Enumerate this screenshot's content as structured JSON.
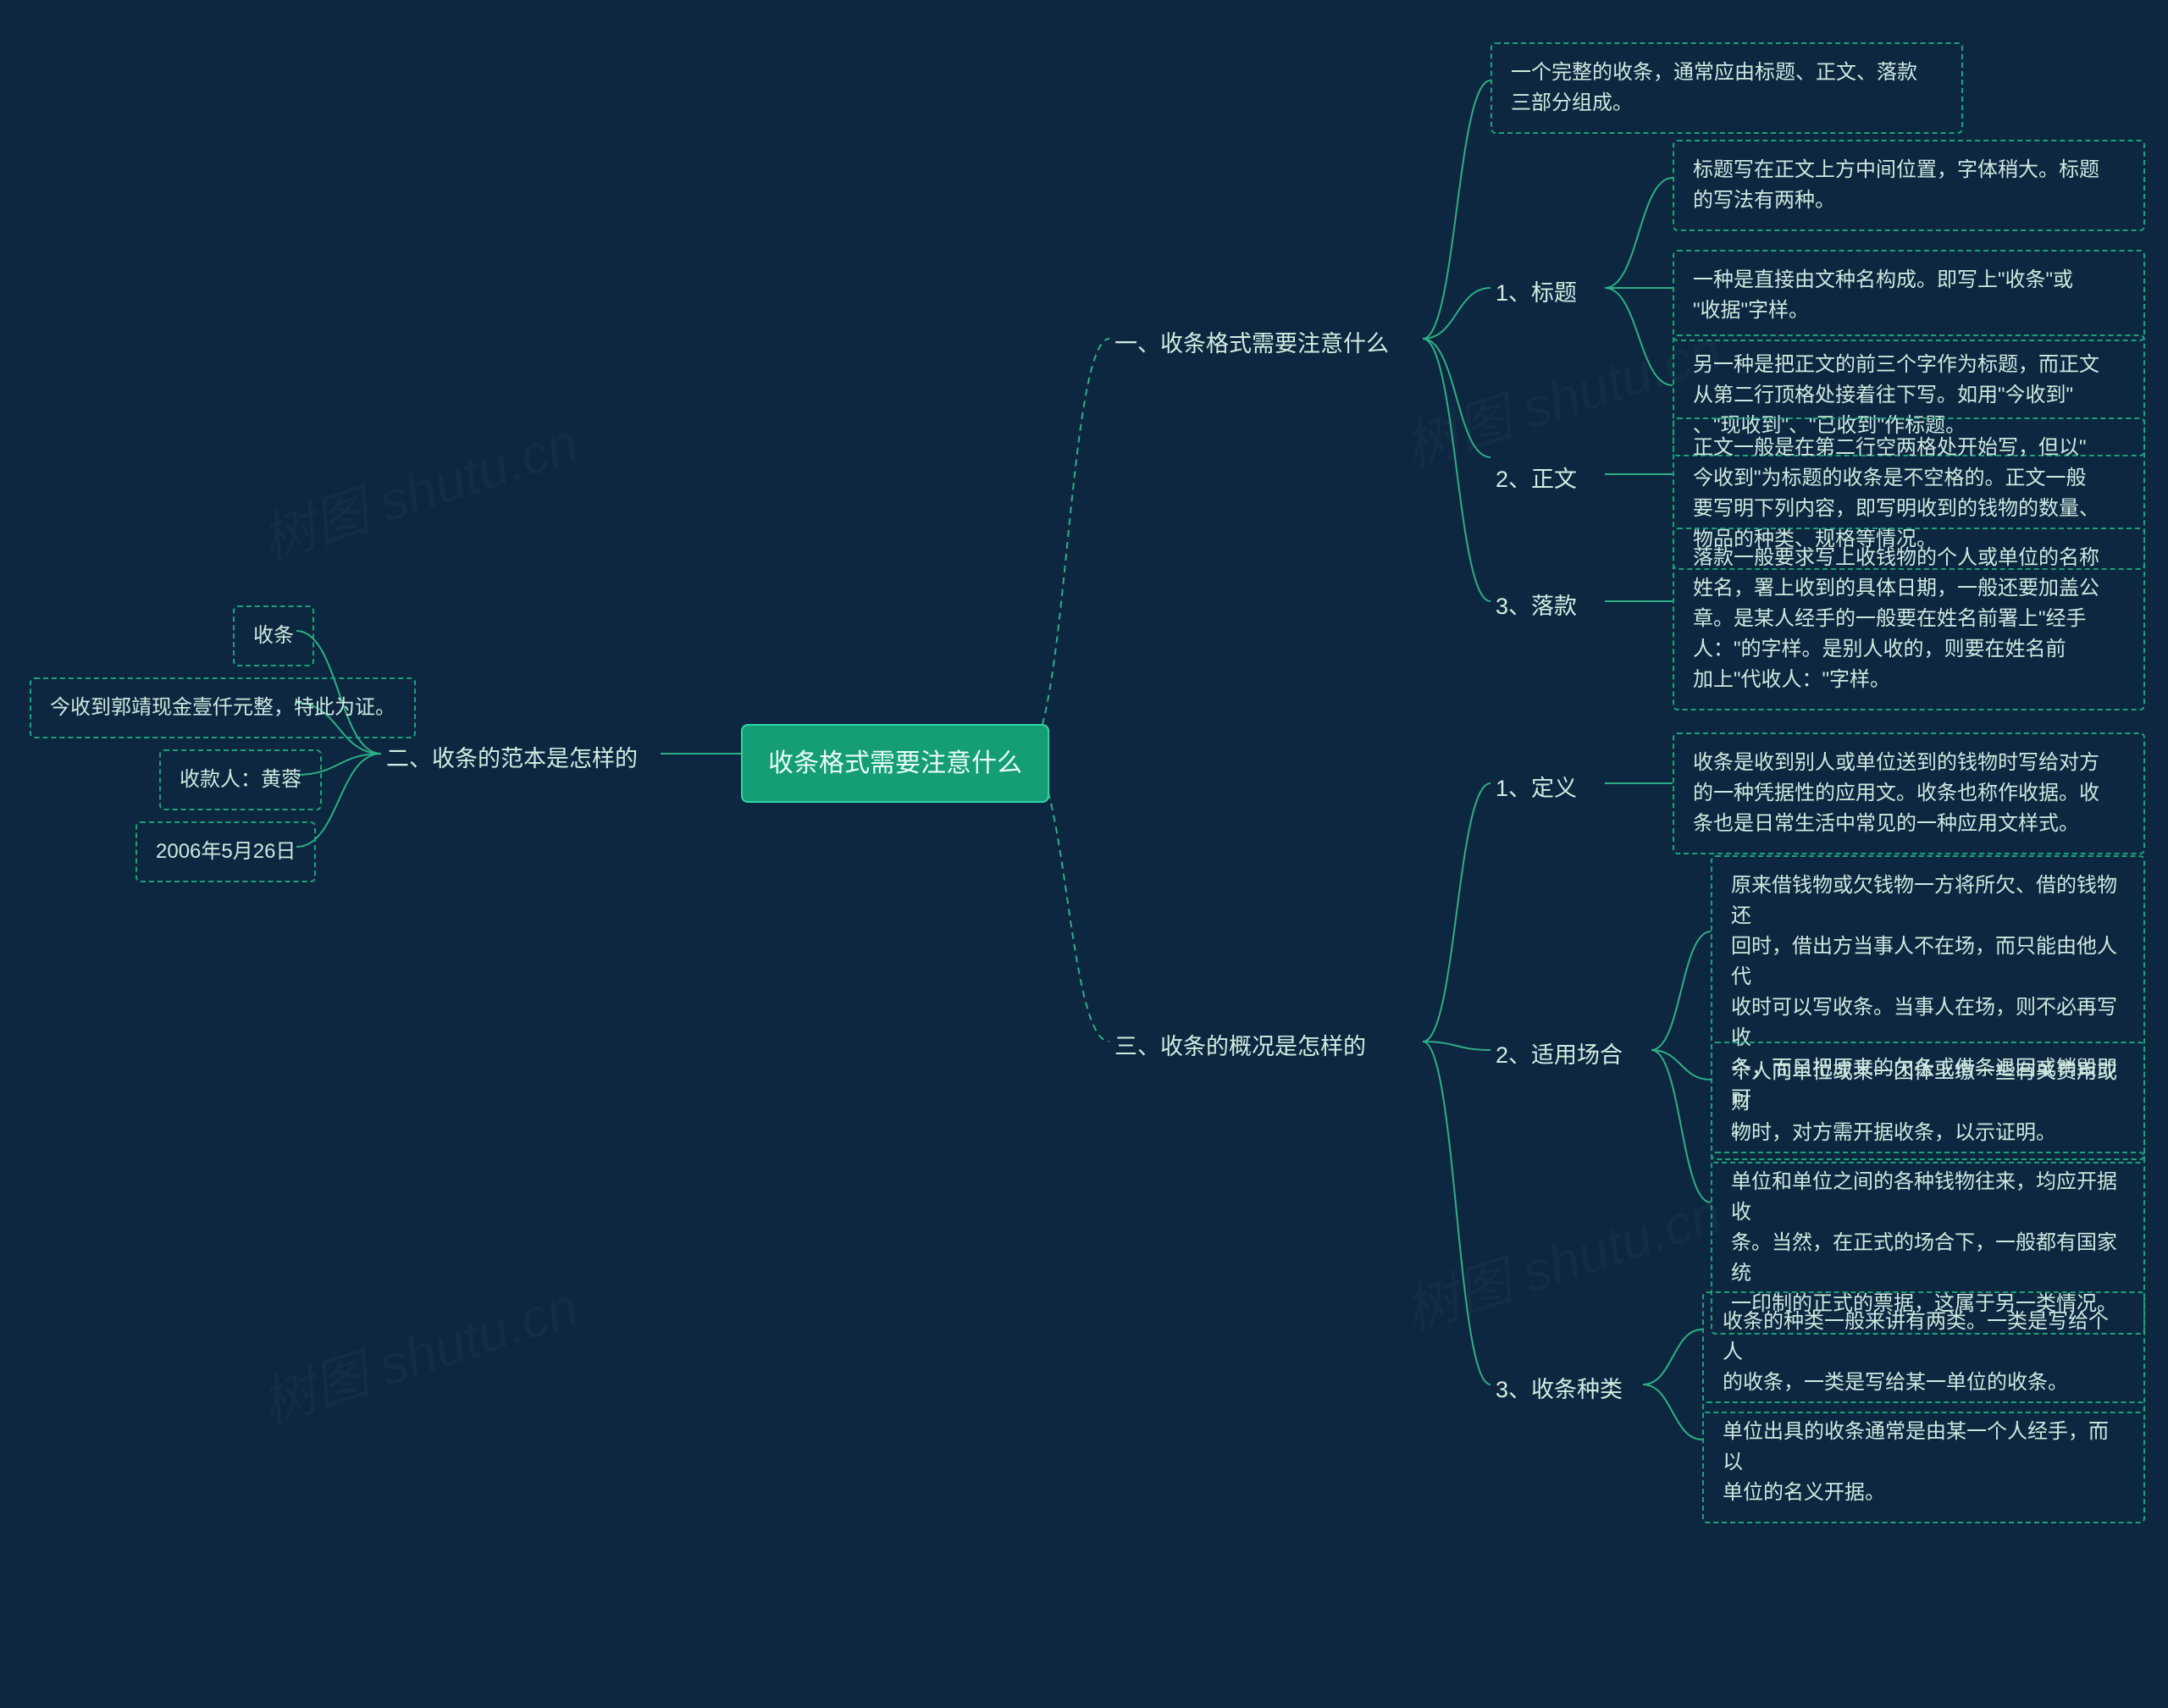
{
  "root": "收条格式需要注意什么",
  "branches": {
    "one": {
      "label": "一、收条格式需要注意什么",
      "c1": "一个完整的收条，通常应由标题、正文、落款\n三部分组成。",
      "b1": {
        "label": "1、标题",
        "a": "标题写在正文上方中间位置，字体稍大。标题\n的写法有两种。",
        "b": "一种是直接由文种名构成。即写上\"收条\"或\n\"收据\"字样。",
        "c": "另一种是把正文的前三个字作为标题，而正文\n从第二行顶格处接着往下写。如用\"今收到\"\n、\"现收到\"、\"已收到\"作标题。"
      },
      "b2": {
        "label": "2、正文",
        "a": "正文一般是在第二行空两格处开始写，但以\"\n今收到\"为标题的收条是不空格的。正文一般\n要写明下列内容，即写明收到的钱物的数量、\n物品的种类、规格等情况。"
      },
      "b3": {
        "label": "3、落款",
        "a": "落款一般要求写上收钱物的个人或单位的名称\n姓名，署上收到的具体日期，一般还要加盖公\n章。是某人经手的一般要在姓名前署上\"经手\n人：\"的字样。是别人收的，则要在姓名前\n加上\"代收人：\"字样。"
      }
    },
    "two": {
      "label": "二、收条的范本是怎样的",
      "items": {
        "a": "收条",
        "b": "今收到郭靖现金壹仟元整，特此为证。",
        "c": "收款人：黄蓉",
        "d": "2006年5月26日"
      }
    },
    "three": {
      "label": "三、收条的概况是怎样的",
      "b1": {
        "label": "1、定义",
        "a": "收条是收到别人或单位送到的钱物时写给对方\n的一种凭据性的应用文。收条也称作收据。收\n条也是日常生活中常见的一种应用文样式。"
      },
      "b2": {
        "label": "2、适用场合",
        "a": "原来借钱物或欠钱物一方将所欠、借的钱物还\n回时，借出方当事人不在场，而只能由他人代\n收时可以写收条。当事人在场，则不必再写收\n条，而只把原来的欠条或借条退回或销毁即可\n。",
        "b": "个人向单位或某一团体上缴一些有关费用或财\n物时，对方需开据收条，以示证明。",
        "c": "单位和单位之间的各种钱物往来，均应开据收\n条。当然，在正式的场合下，一般都有国家统\n一印制的正式的票据，这属于另一类情况。"
      },
      "b3": {
        "label": "3、收条种类",
        "a": "收条的种类一般来讲有两类。一类是写给个人\n的收条，一类是写给某一单位的收条。",
        "b": "单位出具的收条通常是由某一个人经手，而以\n单位的名义开据。"
      }
    }
  },
  "watermark": "树图 shutu.cn"
}
